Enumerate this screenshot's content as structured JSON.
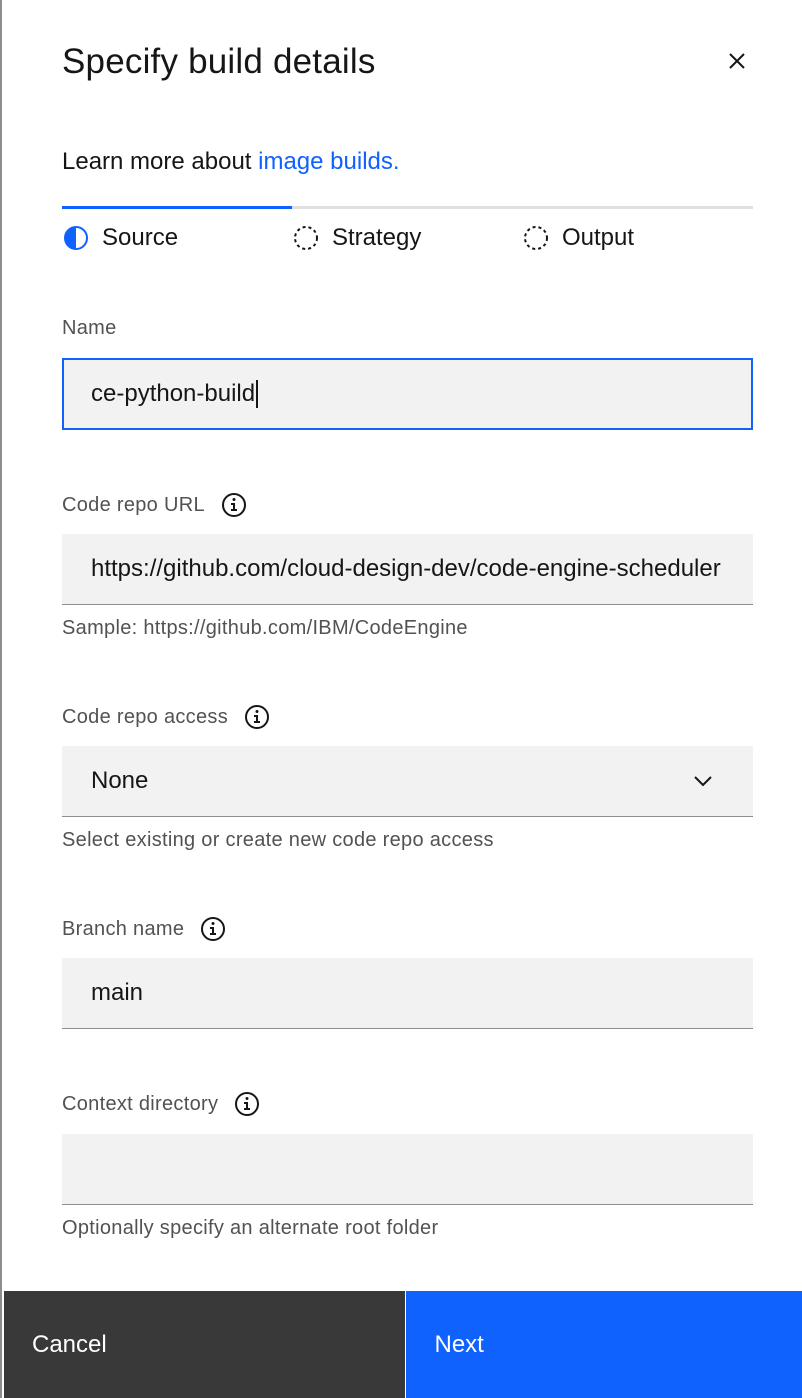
{
  "header": {
    "title": "Specify build details",
    "close_icon": "close-icon"
  },
  "intro": {
    "text": "Learn more about ",
    "link": "image builds."
  },
  "steps": [
    {
      "label": "Source",
      "state": "current"
    },
    {
      "label": "Strategy",
      "state": "incomplete"
    },
    {
      "label": "Output",
      "state": "incomplete"
    }
  ],
  "form": {
    "name": {
      "label": "Name",
      "value": "ce-python-build"
    },
    "code_repo_url": {
      "label": "Code repo URL",
      "value": "https://github.com/cloud-design-dev/code-engine-scheduler",
      "helper": "Sample: https://github.com/IBM/CodeEngine"
    },
    "code_repo_access": {
      "label": "Code repo access",
      "value": "None",
      "helper": "Select existing or create new code repo access"
    },
    "branch_name": {
      "label": "Branch name",
      "value": "main"
    },
    "context_directory": {
      "label": "Context directory",
      "value": "",
      "helper": "Optionally specify an alternate root folder"
    }
  },
  "footer": {
    "cancel_label": "Cancel",
    "next_label": "Next"
  },
  "colors": {
    "accent": "#0f62fe",
    "secondary_button": "#393939",
    "field_bg": "#f2f2f2"
  }
}
